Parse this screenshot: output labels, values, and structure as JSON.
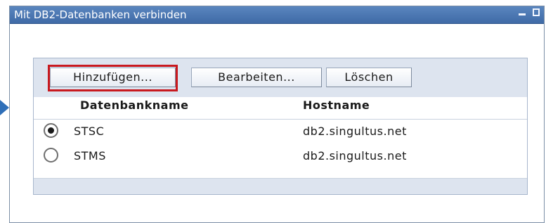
{
  "window": {
    "title": "Mit DB2-Datenbanken verbinden",
    "controls": [
      "minimize-icon",
      "maximize-icon"
    ]
  },
  "toolbar": {
    "add_label": "Hinzufügen...",
    "edit_label": "Bearbeiten...",
    "delete_label": "Löschen"
  },
  "table": {
    "headers": [
      "Datenbankname",
      "Hostname"
    ],
    "rows": [
      {
        "name": "STSC",
        "host": "db2.singultus.net",
        "selected": true
      },
      {
        "name": "STMS",
        "host": "db2.singultus.net",
        "selected": false
      }
    ]
  },
  "colors": {
    "titlebar": "#4a76b1",
    "panel_bar": "#dde4ef",
    "highlight": "#c8191f",
    "pointer": "#2f6fb8"
  }
}
